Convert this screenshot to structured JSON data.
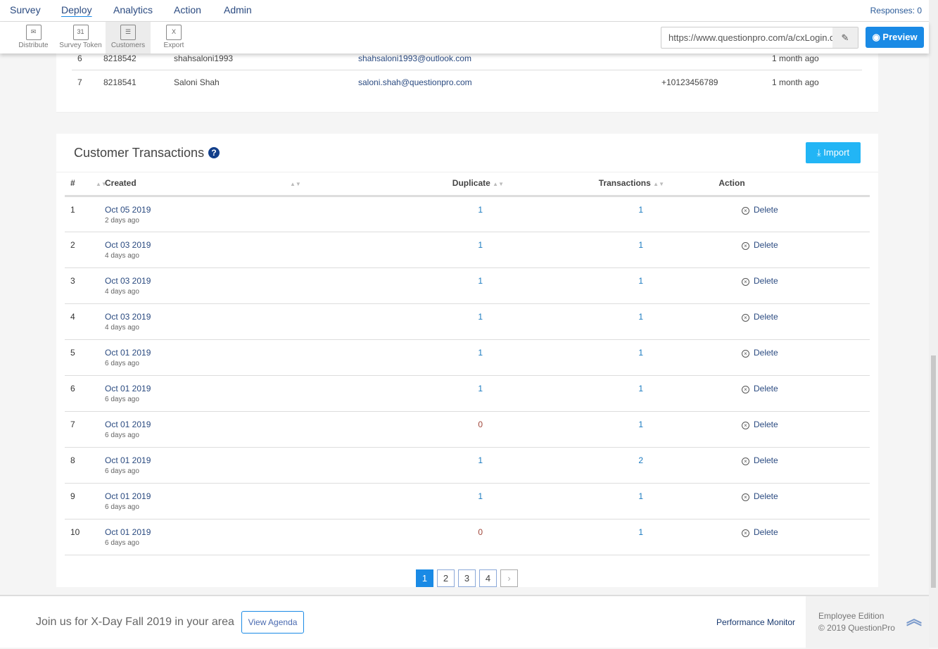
{
  "nav": {
    "items": [
      "Survey",
      "Deploy",
      "Analytics",
      "Action",
      "Admin"
    ],
    "active": "Deploy",
    "responses": "Responses: 0"
  },
  "toolbar": {
    "tools": [
      {
        "label": "Distribute",
        "icon": "✉"
      },
      {
        "label": "Survey Token",
        "icon": "31"
      },
      {
        "label": "Customers",
        "icon": "☰"
      },
      {
        "label": "Export",
        "icon": "X"
      }
    ],
    "url": "https://www.questionpro.com/a/cxLogin.do",
    "preview": "Preview"
  },
  "customers": [
    {
      "n": "6",
      "id": "8218542",
      "name": "shahsaloni1993",
      "email": "shahsaloni1993@outlook.com",
      "phone": "",
      "time": "1 month ago"
    },
    {
      "n": "7",
      "id": "8218541",
      "name": "Saloni Shah",
      "email": "saloni.shah@questionpro.com",
      "phone": "+10123456789",
      "time": "1 month ago"
    }
  ],
  "transactions": {
    "title": "Customer Transactions",
    "import": "Import",
    "headers": {
      "num": "#",
      "created": "Created",
      "duplicate": "Duplicate",
      "transactions": "Transactions",
      "action": "Action"
    },
    "rows": [
      {
        "n": "1",
        "date": "Oct 05 2019",
        "ago": "2 days ago",
        "dup": "1",
        "tx": "1"
      },
      {
        "n": "2",
        "date": "Oct 03 2019",
        "ago": "4 days ago",
        "dup": "1",
        "tx": "1"
      },
      {
        "n": "3",
        "date": "Oct 03 2019",
        "ago": "4 days ago",
        "dup": "1",
        "tx": "1"
      },
      {
        "n": "4",
        "date": "Oct 03 2019",
        "ago": "4 days ago",
        "dup": "1",
        "tx": "1"
      },
      {
        "n": "5",
        "date": "Oct 01 2019",
        "ago": "6 days ago",
        "dup": "1",
        "tx": "1"
      },
      {
        "n": "6",
        "date": "Oct 01 2019",
        "ago": "6 days ago",
        "dup": "1",
        "tx": "1"
      },
      {
        "n": "7",
        "date": "Oct 01 2019",
        "ago": "6 days ago",
        "dup": "0",
        "tx": "1"
      },
      {
        "n": "8",
        "date": "Oct 01 2019",
        "ago": "6 days ago",
        "dup": "1",
        "tx": "2"
      },
      {
        "n": "9",
        "date": "Oct 01 2019",
        "ago": "6 days ago",
        "dup": "1",
        "tx": "1"
      },
      {
        "n": "10",
        "date": "Oct 01 2019",
        "ago": "6 days ago",
        "dup": "0",
        "tx": "1"
      }
    ],
    "delete": "Delete"
  },
  "pagination": {
    "pages": [
      "1",
      "2",
      "3",
      "4"
    ],
    "current": "1",
    "next": "›"
  },
  "footer": {
    "promo": "Join us for X-Day Fall 2019 in your area",
    "agenda": "View Agenda",
    "perf": "Performance Monitor",
    "edition": "Employee Edition",
    "copyright": "© 2019 QuestionPro"
  }
}
